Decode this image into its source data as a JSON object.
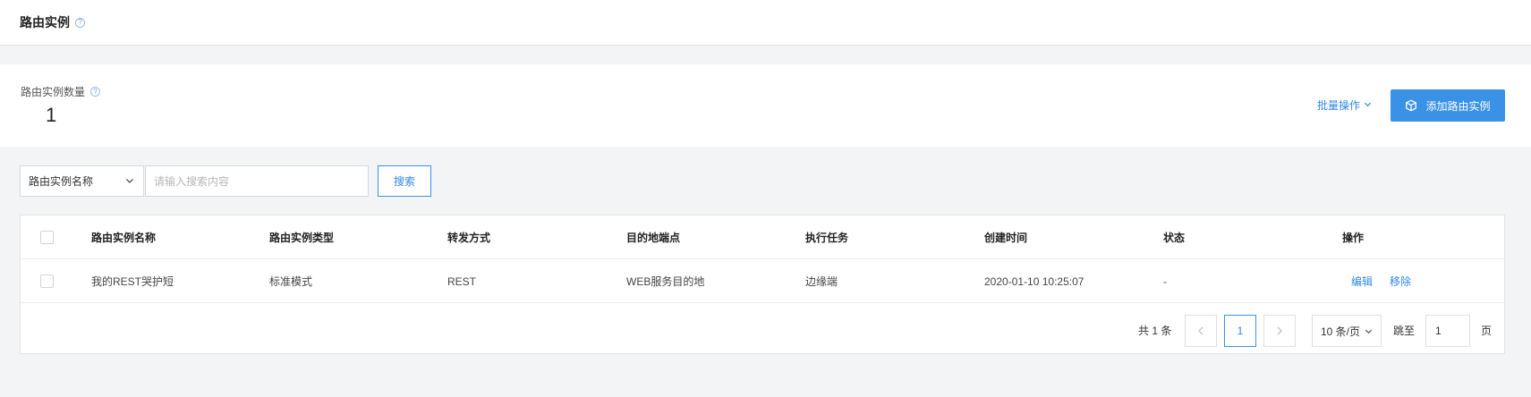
{
  "header": {
    "title": "路由实例"
  },
  "summary": {
    "count_label": "路由实例数量",
    "count_value": "1",
    "batch_label": "批量操作",
    "add_label": "添加路由实例"
  },
  "search": {
    "field_selected": "路由实例名称",
    "placeholder": "请输入搜索内容",
    "button_label": "搜索"
  },
  "table": {
    "columns": [
      "路由实例名称",
      "路由实例类型",
      "转发方式",
      "目的地端点",
      "执行任务",
      "创建时间",
      "状态",
      "操作"
    ],
    "rows": [
      {
        "name": "我的REST哭护短",
        "type": "标准模式",
        "forward": "REST",
        "endpoint": "WEB服务目的地",
        "task": "边缘端",
        "created": "2020-01-10 10:25:07",
        "status": "-",
        "actions": [
          "编辑",
          "移除"
        ]
      }
    ]
  },
  "pagination": {
    "total": "共 1 条",
    "current_page": "1",
    "page_size": "10 条/页",
    "goto_label": "跳至",
    "goto_value": "1",
    "page_unit": "页"
  },
  "colors": {
    "accent": "#3a92e6",
    "link": "#2f88e8",
    "background": "#f3f4f6"
  },
  "icons": {
    "help": "question-circle-icon",
    "add": "cube-icon",
    "dropdown": "chevron-down-icon",
    "prev": "chevron-left-icon",
    "next": "chevron-right-icon"
  }
}
